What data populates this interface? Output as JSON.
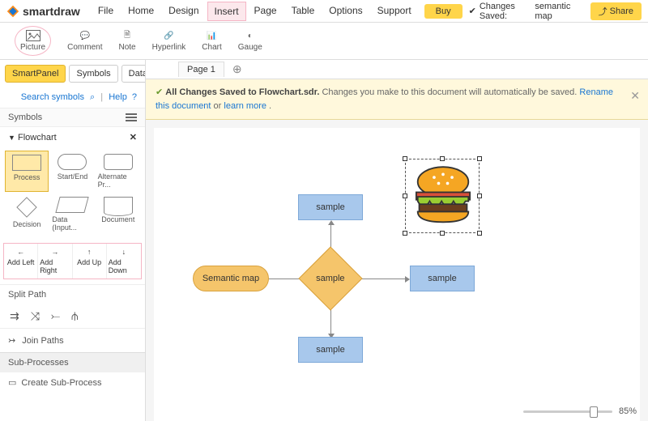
{
  "app": {
    "name": "smartdraw"
  },
  "menu": {
    "items": [
      "File",
      "Home",
      "Design",
      "Insert",
      "Page",
      "Table",
      "Options",
      "Support"
    ],
    "highlighted_index": 3,
    "buy_label": "Buy"
  },
  "header": {
    "save_status_prefix": "Changes Saved: ",
    "save_status_name": "semantic map",
    "share_label": "Share"
  },
  "ribbon": {
    "items": [
      {
        "label": "Picture",
        "icon": "picture-icon"
      },
      {
        "label": "Comment",
        "icon": "comment-icon"
      },
      {
        "label": "Note",
        "icon": "note-icon"
      },
      {
        "label": "Hyperlink",
        "icon": "hyperlink-icon"
      },
      {
        "label": "Chart",
        "icon": "chart-icon"
      },
      {
        "label": "Gauge",
        "icon": "gauge-icon"
      }
    ],
    "circled_index": 0
  },
  "sidebar": {
    "tabs": [
      "SmartPanel",
      "Symbols",
      "Data"
    ],
    "active_tab_index": 0,
    "search_label": "Search symbols",
    "help_label": "Help",
    "symbols_header": "Symbols",
    "category_label": "Flowchart",
    "shapes": [
      {
        "label": "Process",
        "kind": "rect",
        "active": true
      },
      {
        "label": "Start/End",
        "kind": "round"
      },
      {
        "label": "Alternate Pr...",
        "kind": "roundrect"
      },
      {
        "label": "Decision",
        "kind": "diamond"
      },
      {
        "label": "Data (Input...",
        "kind": "para"
      },
      {
        "label": "Document",
        "kind": "doc"
      }
    ],
    "quick_add": [
      "Add Left",
      "Add Right",
      "Add Up",
      "Add Down"
    ],
    "split_header": "Split Path",
    "join_label": "Join Paths",
    "sub_header": "Sub-Processes",
    "create_sub_label": "Create Sub-Process"
  },
  "pages": {
    "tabs": [
      "Page 1"
    ]
  },
  "banner": {
    "bold": "All Changes Saved to Flowchart.sdr.",
    "text1": " Changes you make to this document will automatically be saved. ",
    "link1": "Rename this document",
    "text2": " or ",
    "link2": "learn more",
    "text3": "."
  },
  "canvas": {
    "nodes": {
      "start": "Semantic map",
      "top": "sample",
      "center": "sample",
      "right": "sample",
      "bottom": "sample"
    }
  },
  "zoom": {
    "value": "85%"
  }
}
